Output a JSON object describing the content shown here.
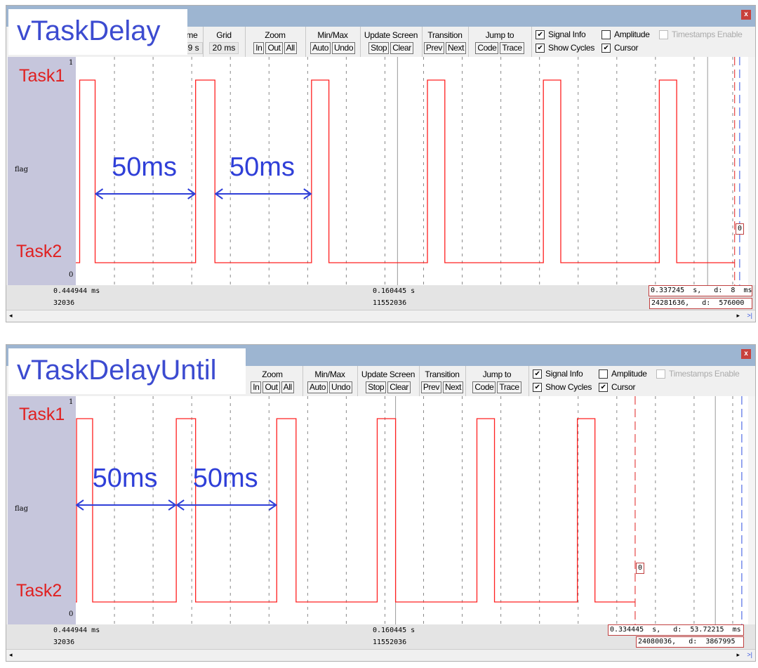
{
  "panels": [
    {
      "overlay_title": "vTaskDelay",
      "close_label": "x",
      "toolbar": {
        "time_label": "Time",
        "time_value": "789 s",
        "grid_label": "Grid",
        "grid_value": "20 ms",
        "zoom_label": "Zoom",
        "zoom_buttons": [
          "In",
          "Out",
          "All"
        ],
        "minmax_label": "Min/Max",
        "minmax_buttons": [
          "Auto",
          "Undo"
        ],
        "update_label": "Update Screen",
        "update_buttons": [
          "Stop",
          "Clear"
        ],
        "transition_label": "Transition",
        "transition_buttons": [
          "Prev",
          "Next"
        ],
        "jump_label": "Jump to",
        "jump_buttons": [
          "Code",
          "Trace"
        ],
        "checkboxes": [
          {
            "label": "Signal Info",
            "checked": true
          },
          {
            "label": "Show Cycles",
            "checked": true
          },
          {
            "label": "Amplitude",
            "checked": false
          },
          {
            "label": "Cursor",
            "checked": true
          },
          {
            "label": "Timestamps Enable",
            "checked": false,
            "disabled": true
          }
        ]
      },
      "signal": {
        "name": "flag",
        "y_max": "1",
        "y_min": "0",
        "high_label": "Task1",
        "low_label": "Task2"
      },
      "status": {
        "left_time": "0.444944 ms",
        "left_cycles": "32036",
        "mid_time": "0.160445 s",
        "mid_cycles": "11552036",
        "cursor_time": "0.337245  s,   d:  8  ms",
        "cursor_cycles": "24281636,   d:  576000",
        "cursor_value": "0"
      },
      "scroll": {
        "left": "◂",
        "right": "▸",
        "end": ">|"
      }
    },
    {
      "overlay_title": "vTaskDelayUntil",
      "close_label": "x",
      "toolbar": {
        "zoom_label": "Zoom",
        "zoom_buttons": [
          "In",
          "Out",
          "All"
        ],
        "minmax_label": "Min/Max",
        "minmax_buttons": [
          "Auto",
          "Undo"
        ],
        "update_label": "Update Screen",
        "update_buttons": [
          "Stop",
          "Clear"
        ],
        "transition_label": "Transition",
        "transition_buttons": [
          "Prev",
          "Next"
        ],
        "jump_label": "Jump to",
        "jump_buttons": [
          "Code",
          "Trace"
        ],
        "checkboxes": [
          {
            "label": "Signal Info",
            "checked": true
          },
          {
            "label": "Show Cycles",
            "checked": true
          },
          {
            "label": "Amplitude",
            "checked": false
          },
          {
            "label": "Cursor",
            "checked": true
          },
          {
            "label": "Timestamps Enable",
            "checked": false,
            "disabled": true
          }
        ]
      },
      "signal": {
        "name": "flag",
        "y_max": "1",
        "y_min": "0",
        "high_label": "Task1",
        "low_label": "Task2"
      },
      "status": {
        "left_time": "0.444944 ms",
        "left_cycles": "32036",
        "mid_time": "0.160445 s",
        "mid_cycles": "11552036",
        "cursor_time": "0.334445  s,   d:  53.72215  ms",
        "cursor_cycles": "24080036,   d:  3867995",
        "cursor_value": "0"
      },
      "scroll": {
        "left": "◂",
        "right": "▸",
        "end": ">|"
      }
    }
  ],
  "chart_data": [
    {
      "type": "line",
      "x_unit": "ms",
      "x_range": [
        0,
        348
      ],
      "grid_step_ms": 20,
      "y_range": [
        0,
        1
      ],
      "pulses_high": [
        [
          2,
          10
        ],
        [
          62,
          72
        ],
        [
          122,
          131
        ],
        [
          182,
          191
        ],
        [
          242,
          251
        ],
        [
          302,
          311
        ]
      ],
      "cursors": {
        "gray": [
          166.5,
          327
        ],
        "red": 341,
        "blue": 343.6
      },
      "annotations": [
        {
          "text": "50ms",
          "from": 10,
          "to": 62
        },
        {
          "text": "50ms",
          "from": 72,
          "to": 122
        }
      ],
      "colors": {
        "signal": "#ff2020",
        "annotation": "#2f3fd8"
      }
    },
    {
      "type": "line",
      "x_unit": "ms",
      "x_range": [
        0,
        348
      ],
      "grid_step_ms": 20,
      "y_range": [
        0,
        1
      ],
      "pulses_high": [
        [
          0.4,
          8.7
        ],
        [
          52,
          62
        ],
        [
          104,
          114
        ],
        [
          156,
          165.5
        ],
        [
          207.6,
          216.7
        ],
        [
          259.6,
          268.7
        ]
      ],
      "cursors": {
        "gray": [
          165.5,
          331
        ],
        "red": 289.5,
        "blue": 344.7
      },
      "annotations": [
        {
          "text": "50ms",
          "from": 0,
          "to": 52
        },
        {
          "text": "50ms",
          "from": 52,
          "to": 104
        }
      ],
      "colors": {
        "signal": "#ff2020",
        "annotation": "#2f3fd8"
      }
    }
  ]
}
